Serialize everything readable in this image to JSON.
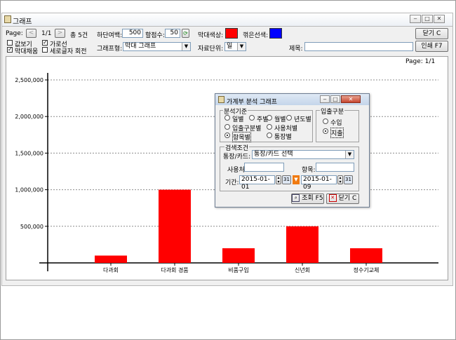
{
  "window": {
    "title": "그래프"
  },
  "toolbar": {
    "page_label": "Page:",
    "page_value": "1/1",
    "total_label": "총 5건",
    "bottom_margin_label": "하단여백:",
    "bottom_margin_value": "500",
    "scale_label": "할점수:",
    "scale_value": "50",
    "bar_color_label": "막대색상:",
    "bar_color": "#ff0000",
    "line_color_label": "꺾은선색:",
    "line_color": "#0000ff",
    "close_button": "닫기 C",
    "print_button": "인쇄 F7",
    "show_values_label": "값보기",
    "fill_bars_label": "막대채움",
    "gridline_label": "가로선",
    "rotate_label": "세로글자 회전",
    "chart_type_label": "그래프형:",
    "chart_type_value": "막대 그래프",
    "unit_label": "자료단위:",
    "unit_value": "일",
    "title_label": "제목:",
    "title_value": ""
  },
  "chart": {
    "page_indicator": "Page: 1/1"
  },
  "chart_data": {
    "type": "bar",
    "categories": [
      "다과회",
      "다과회 경품",
      "비품구입",
      "신년회",
      "정수기교체"
    ],
    "values": [
      100000,
      1000000,
      200000,
      500000,
      200000
    ],
    "ylim": [
      0,
      2500000
    ],
    "yticks": [
      "500,000",
      "1,000,000",
      "1,500,000",
      "2,000,000",
      "2,500,000"
    ],
    "ytick_values": [
      500000,
      1000000,
      1500000,
      2000000,
      2500000
    ],
    "bar_color": "#ff0000",
    "grid": true
  },
  "dialog": {
    "title": "가계부 분석 그래프",
    "basis_group": "분석기준",
    "basis_options": [
      "일별",
      "주별",
      "월별",
      "년도별",
      "입출구분별",
      "사용처별",
      "항목별",
      "통장별"
    ],
    "basis_selected": "항목별",
    "inout_group": "입출구분",
    "inout_options": [
      "수입",
      "지출"
    ],
    "inout_selected": "지출",
    "search_group": "검색조건",
    "account_label": "통장/카드:",
    "account_value": "통장/카드 선택",
    "place_label": "사용처:",
    "place_value": "",
    "item_label": "항목:",
    "item_value": "",
    "period_label": "기간:",
    "date_from": "2015-01-01",
    "date_to": "2015-01-09",
    "search_button": "조회 F5",
    "close_button": "닫기 C"
  }
}
